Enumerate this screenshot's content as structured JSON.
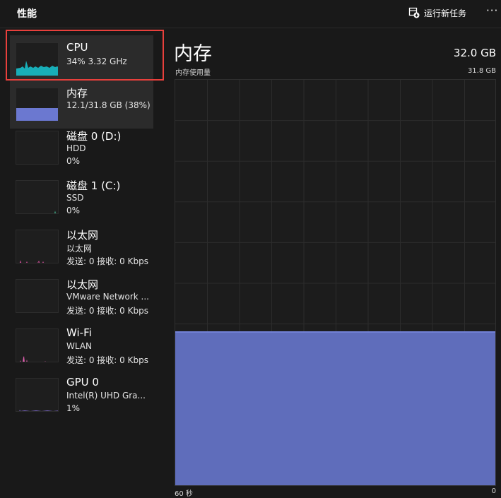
{
  "header": {
    "title": "性能",
    "run_new_task": "运行新任务",
    "more": "···"
  },
  "sidebar": {
    "items": [
      {
        "id": "cpu",
        "title": "CPU",
        "line1": "34%  3.32 GHz",
        "line2": "",
        "graph_color": "#18aeb8",
        "selected": false,
        "outlined": true
      },
      {
        "id": "memory",
        "title": "内存",
        "line1": "12.1/31.8 GB (38%)",
        "line2": "",
        "graph_color": "#6b78d0",
        "selected": true,
        "usage_fraction": 0.38
      },
      {
        "id": "disk0",
        "title": "磁盘 0 (D:)",
        "line1": "HDD",
        "line2": "0%",
        "graph_color": "#3b9a7a"
      },
      {
        "id": "disk1",
        "title": "磁盘 1 (C:)",
        "line1": "SSD",
        "line2": "0%",
        "graph_color": "#3b9a7a"
      },
      {
        "id": "ethernet1",
        "title": "以太网",
        "line1": "以太网",
        "line2": "发送: 0 接收: 0 Kbps",
        "graph_color": "#c04a8e"
      },
      {
        "id": "ethernet2",
        "title": "以太网",
        "line1": "VMware Network ...",
        "line2": "发送: 0 接收: 0 Kbps",
        "graph_color": "#c04a8e"
      },
      {
        "id": "wifi",
        "title": "Wi-Fi",
        "line1": "WLAN",
        "line2": "发送: 0 接收: 0 Kbps",
        "graph_color": "#e060b0"
      },
      {
        "id": "gpu0",
        "title": "GPU 0",
        "line1": "Intel(R) UHD Gra...",
        "line2": "1%",
        "graph_color": "#7c66c8"
      }
    ]
  },
  "main": {
    "title": "内存",
    "total": "32.0 GB",
    "usage_label": "内存使用量",
    "usage_max": "31.8 GB",
    "x_axis_left": "60 秒",
    "x_axis_right": "0",
    "usage_fraction": 0.38,
    "fill_color": "#5f6dbb",
    "line_color": "#7281d6"
  }
}
